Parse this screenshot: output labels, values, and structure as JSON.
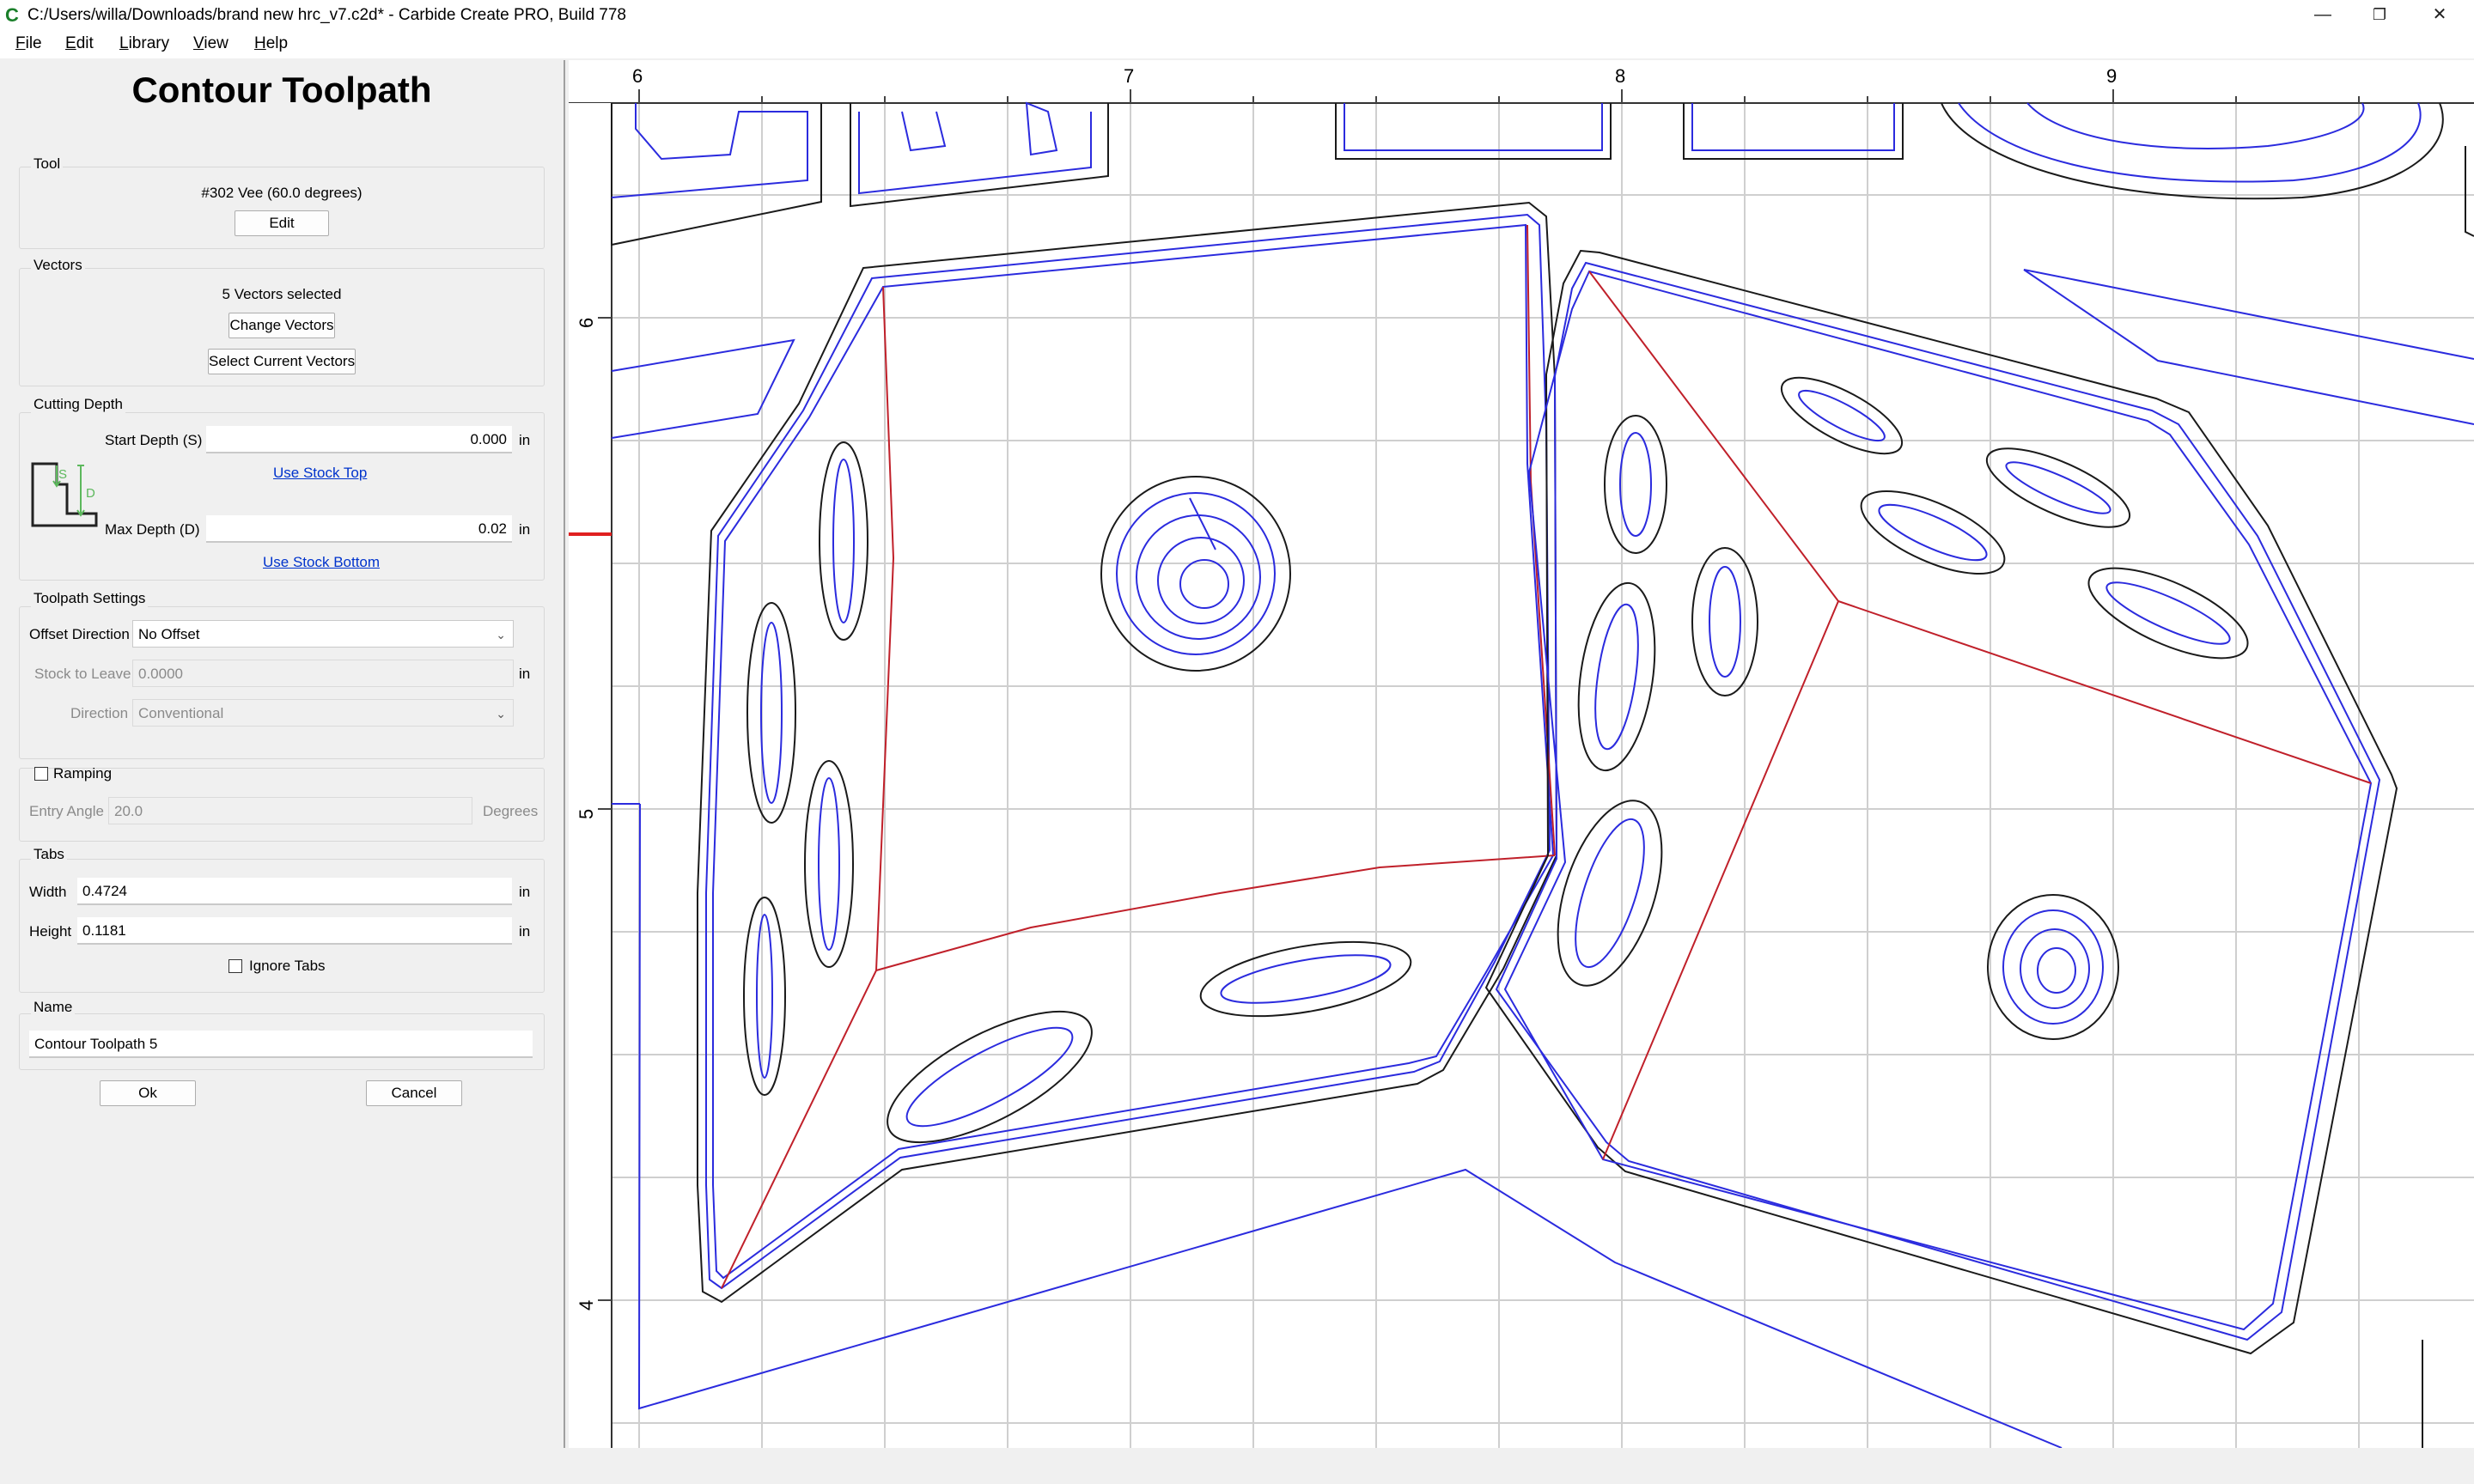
{
  "window": {
    "title": "C:/Users/willa/Downloads/brand new hrc_v7.c2d* - Carbide Create PRO, Build 778",
    "app_icon": "C",
    "controls": {
      "minimize": "—",
      "restore": "❐",
      "close": "✕"
    }
  },
  "menu": {
    "items": [
      {
        "label": "File",
        "accel": "F",
        "rest": "ile"
      },
      {
        "label": "Edit",
        "accel": "E",
        "rest": "dit"
      },
      {
        "label": "Library",
        "accel": "L",
        "rest": "ibrary"
      },
      {
        "label": "View",
        "accel": "V",
        "rest": "iew"
      },
      {
        "label": "Help",
        "accel": "H",
        "rest": "elp"
      }
    ]
  },
  "panel": {
    "title": "Contour Toolpath",
    "tool": {
      "group_label": "Tool",
      "tool_name": "#302 Vee (60.0 degrees)",
      "edit_label": "Edit"
    },
    "vectors": {
      "group_label": "Vectors",
      "selected_text": "5 Vectors selected",
      "change_label": "Change Vectors",
      "select_current_label": "Select Current Vectors"
    },
    "cutting_depth": {
      "group_label": "Cutting Depth",
      "start_label": "Start Depth (S)",
      "start_value": "0.000",
      "start_unit": "in",
      "use_stock_top": "Use Stock Top",
      "max_label": "Max Depth (D)",
      "max_value": "0.02",
      "max_unit": "in",
      "use_stock_bottom": "Use Stock Bottom",
      "diagram_s": "S",
      "diagram_d": "D"
    },
    "toolpath_settings": {
      "group_label": "Toolpath Settings",
      "offset_label": "Offset Direction",
      "offset_value": "No Offset",
      "stock_label": "Stock to Leave",
      "stock_value": "0.0000",
      "stock_unit": "in",
      "direction_label": "Direction",
      "direction_value": "Conventional"
    },
    "ramping": {
      "label": "Ramping",
      "checked": false,
      "entry_label": "Entry Angle",
      "entry_value": "20.0",
      "entry_unit": "Degrees"
    },
    "tabs": {
      "group_label": "Tabs",
      "width_label": "Width",
      "width_value": "0.4724",
      "width_unit": "in",
      "height_label": "Height",
      "height_value": "0.1181",
      "height_unit": "in",
      "ignore_label": "Ignore Tabs",
      "ignore_checked": false
    },
    "name": {
      "group_label": "Name",
      "value": "Contour Toolpath 5"
    },
    "ok_label": "Ok",
    "cancel_label": "Cancel"
  },
  "canvas": {
    "ruler_x_labels": [
      "6",
      "7",
      "8",
      "9"
    ],
    "ruler_y_labels": [
      "6",
      "5",
      "4"
    ],
    "colors": {
      "outline": "#1a1a1a",
      "toolpath": "#2b2bde",
      "selected": "#c0202a",
      "grid": "#cfcfcf",
      "marker": "#e02020"
    }
  }
}
